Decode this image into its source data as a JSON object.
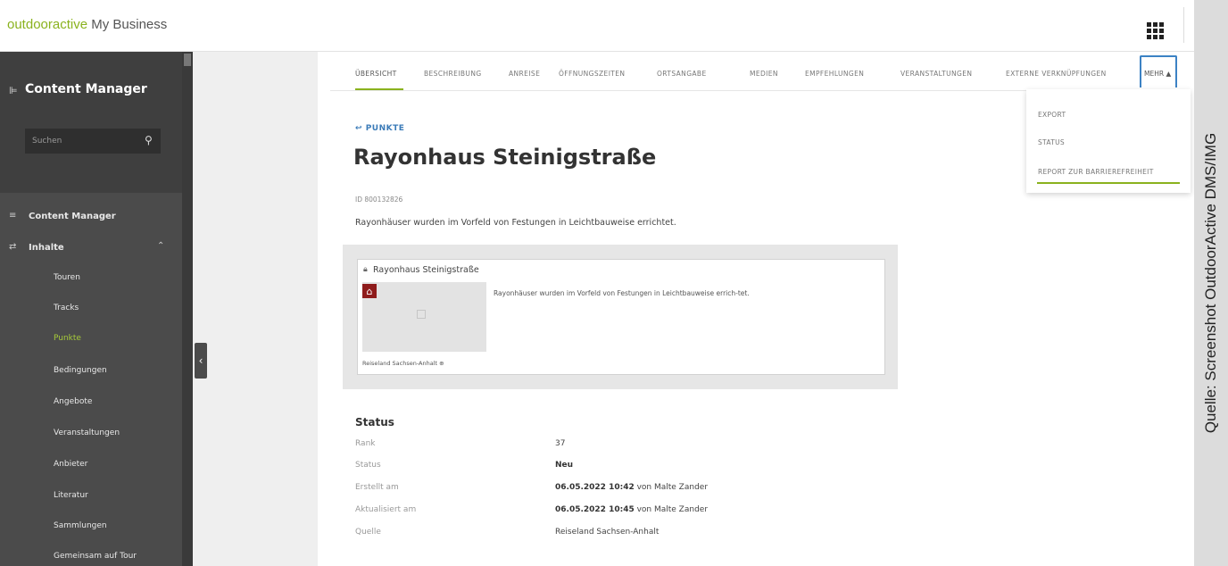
{
  "brand": {
    "part1": "outdooractive",
    "part2": "My Business"
  },
  "sidebar": {
    "title": "Content Manager",
    "search_placeholder": "Suchen",
    "items": [
      {
        "label": "Content Manager",
        "type": "section"
      },
      {
        "label": "Inhalte",
        "type": "section"
      },
      {
        "label": "Touren",
        "type": "child"
      },
      {
        "label": "Tracks",
        "type": "child"
      },
      {
        "label": "Punkte",
        "type": "child",
        "active": true
      },
      {
        "label": "Bedingungen",
        "type": "child"
      },
      {
        "label": "Angebote",
        "type": "child"
      },
      {
        "label": "Veranstaltungen",
        "type": "child"
      },
      {
        "label": "Anbieter",
        "type": "child"
      },
      {
        "label": "Literatur",
        "type": "child"
      },
      {
        "label": "Sammlungen",
        "type": "child"
      },
      {
        "label": "Gemeinsam auf Tour",
        "type": "child"
      }
    ]
  },
  "tabs": [
    {
      "label": "ÜBERSICHT",
      "active": true
    },
    {
      "label": "BESCHREIBUNG"
    },
    {
      "label": "ANREISE"
    },
    {
      "label": "ÖFFNUNGSZEITEN"
    },
    {
      "label": "ORTSANGABE"
    },
    {
      "label": "MEDIEN"
    },
    {
      "label": "EMPFEHLUNGEN"
    },
    {
      "label": "VERANSTALTUNGEN"
    },
    {
      "label": "EXTERNE VERKNÜPFUNGEN"
    }
  ],
  "more_tab": {
    "label": "MEHR ▲"
  },
  "dropdown": {
    "items": [
      "EXPORT",
      "STATUS",
      "REPORT ZUR BARRIEREFREIHEIT"
    ]
  },
  "page": {
    "back_link": "PUNKTE",
    "title": "Rayonhaus Steinigstraße",
    "id": "ID 800132826",
    "description": "Rayonhäuser wurden im Vorfeld von Festungen in Leichtbauweise errichtet."
  },
  "card": {
    "title": "Rayonhaus Steinigstraße",
    "text": "Rayonhäuser wurden im Vorfeld von Festungen in Leichtbauweise errich-tet.",
    "source": "Reiseland Sachsen-Anhalt"
  },
  "status": {
    "heading": "Status",
    "rows": [
      {
        "label": "Rank",
        "value": "37"
      },
      {
        "label": "Status",
        "value": "Neu"
      },
      {
        "label": "Erstellt am",
        "date": "06.05.2022 10:42",
        "by": " von Malte Zander"
      },
      {
        "label": "Aktualisiert am",
        "date": "06.05.2022 10:45",
        "by": " von Malte Zander"
      },
      {
        "label": "Quelle",
        "value": "Reiseland Sachsen-Anhalt"
      }
    ]
  },
  "credit": "Quelle: Screenshot OutdoorActive DMS/IMG",
  "colors": {
    "brand_green": "#8ab21e",
    "link_blue": "#3b7bb8",
    "sidebar": "#4b4b4b",
    "poi_red": "#8f1c1c"
  }
}
